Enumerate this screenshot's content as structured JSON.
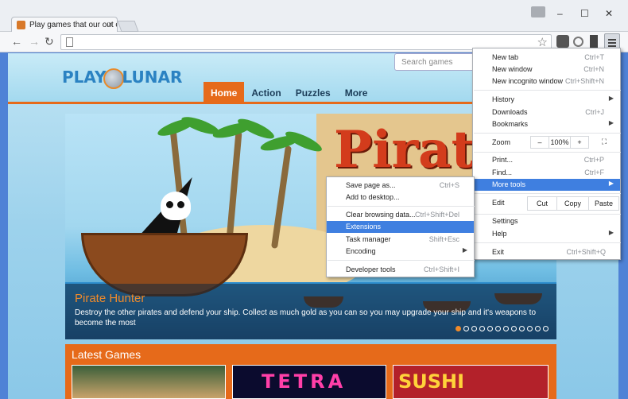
{
  "browser": {
    "tab_title": "Play games that our out o",
    "tab_close": "×",
    "window_controls": {
      "minimize": "–",
      "maximize": "☐",
      "close": "✕"
    },
    "back": "←",
    "forward": "→",
    "reload": "↻",
    "star": "☆"
  },
  "site": {
    "logo_left": "PLAY",
    "logo_right": "LUNAR",
    "search_placeholder": "Search games",
    "nav": [
      "Home",
      "Action",
      "Puzzles",
      "More"
    ],
    "active_nav": "Home",
    "banner": {
      "art_word": "Pirat",
      "title": "Pirate Hunter",
      "description": "Destroy the other pirates and defend your ship. Collect as much gold as you can so you may upgrade your ship and it's weapons to become the most",
      "slide_count": 12,
      "active_slide": 1
    },
    "latest_label": "Latest Games",
    "thumbnails": [
      "",
      "TETRA",
      "SUSHI"
    ]
  },
  "main_menu": {
    "items": [
      {
        "label": "New tab",
        "shortcut": "Ctrl+T"
      },
      {
        "label": "New window",
        "shortcut": "Ctrl+N"
      },
      {
        "label": "New incognito window",
        "shortcut": "Ctrl+Shift+N"
      },
      {
        "label": "History",
        "shortcut": "",
        "submenu": true
      },
      {
        "label": "Downloads",
        "shortcut": "Ctrl+J"
      },
      {
        "label": "Bookmarks",
        "shortcut": "",
        "submenu": true
      },
      {
        "label": "Print...",
        "shortcut": "Ctrl+P"
      },
      {
        "label": "Find...",
        "shortcut": "Ctrl+F"
      },
      {
        "label": "More tools",
        "shortcut": "",
        "submenu": true,
        "highlighted": true
      },
      {
        "label": "Settings",
        "shortcut": ""
      },
      {
        "label": "Help",
        "shortcut": "",
        "submenu": true
      },
      {
        "label": "Exit",
        "shortcut": "Ctrl+Shift+Q"
      }
    ],
    "zoom": {
      "label": "Zoom",
      "minus": "–",
      "value": "100%",
      "plus": "+",
      "fullscreen": "⛶"
    },
    "edit": {
      "label": "Edit",
      "cut": "Cut",
      "copy": "Copy",
      "paste": "Paste"
    }
  },
  "more_tools_menu": {
    "items": [
      {
        "label": "Save page as...",
        "shortcut": "Ctrl+S"
      },
      {
        "label": "Add to desktop...",
        "shortcut": ""
      },
      {
        "label": "Clear browsing data...",
        "shortcut": "Ctrl+Shift+Del"
      },
      {
        "label": "Extensions",
        "shortcut": "",
        "highlighted": true
      },
      {
        "label": "Task manager",
        "shortcut": "Shift+Esc"
      },
      {
        "label": "Encoding",
        "shortcut": "",
        "submenu": true
      },
      {
        "label": "Developer tools",
        "shortcut": "Ctrl+Shift+I"
      }
    ]
  },
  "colors": {
    "accent": "#e66a1a",
    "menu_highlight": "#3f7fe0"
  }
}
